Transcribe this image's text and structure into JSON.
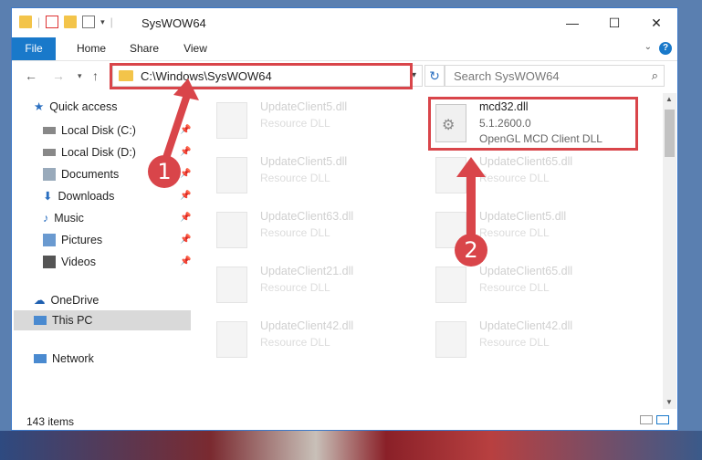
{
  "window": {
    "title": "SysWOW64"
  },
  "controls": {
    "minimize": "—",
    "maximize": "☐",
    "close": "✕"
  },
  "ribbon": {
    "tabs": [
      "File",
      "Home",
      "Share",
      "View"
    ]
  },
  "address": {
    "path": "C:\\Windows\\SysWOW64",
    "search_placeholder": "Search SysWOW64"
  },
  "nav": {
    "items": [
      {
        "label": "Quick access",
        "icon": "star-icon"
      },
      {
        "label": "Local Disk (C:)",
        "icon": "drive-icon"
      },
      {
        "label": "Local Disk (D:)",
        "icon": "drive-icon"
      },
      {
        "label": "Documents",
        "icon": "documents-icon"
      },
      {
        "label": "Downloads",
        "icon": "download-icon"
      },
      {
        "label": "Music",
        "icon": "music-icon"
      },
      {
        "label": "Pictures",
        "icon": "pictures-icon"
      },
      {
        "label": "Videos",
        "icon": "videos-icon"
      },
      {
        "label": "OneDrive",
        "icon": "cloud-icon"
      },
      {
        "label": "This PC",
        "icon": "pc-icon"
      },
      {
        "label": "Network",
        "icon": "network-icon"
      }
    ]
  },
  "files": {
    "left": [
      {
        "name": "UpdateClient5.dll",
        "type": "Resource DLL"
      },
      {
        "name": "UpdateClient5.dll",
        "type": "Resource DLL"
      },
      {
        "name": "UpdateClient63.dll",
        "type": "Resource DLL"
      },
      {
        "name": "UpdateClient21.dll",
        "type": "Resource DLL"
      },
      {
        "name": "UpdateClient42.dll",
        "type": "Resource DLL"
      }
    ],
    "right": [
      {
        "name": "UpdateClient65.dll",
        "type": "Resource DLL"
      },
      {
        "name": "UpdateClient5.dll",
        "type": "Resource DLL"
      },
      {
        "name": "UpdateClient65.dll",
        "type": "Resource DLL"
      },
      {
        "name": "UpdateClient42.dll",
        "type": "Resource DLL"
      }
    ],
    "highlight": {
      "name": "mcd32.dll",
      "version": "5.1.2600.0",
      "description": "OpenGL MCD Client DLL"
    }
  },
  "status": {
    "count": "143 items"
  },
  "callouts": {
    "one": "1",
    "two": "2"
  },
  "colors": {
    "accent": "#1979ca",
    "annotation": "#d9454a"
  }
}
